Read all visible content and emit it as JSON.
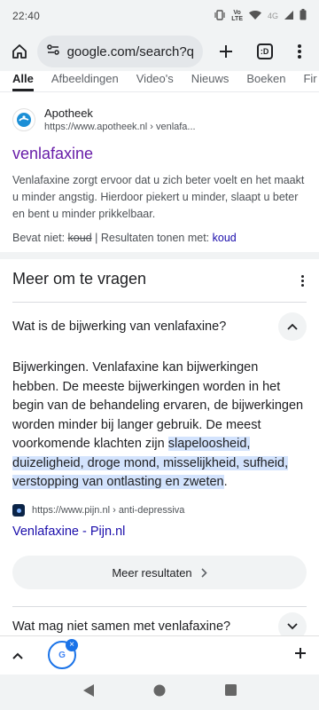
{
  "status_bar": {
    "time": "22:40",
    "network_type": "LTE",
    "signal_label": "Vo",
    "data_badge": "4G",
    "icons": [
      "vibrate-icon",
      "volte-icon",
      "wifi-icon",
      "signal-icon",
      "battery-icon"
    ]
  },
  "toolbar": {
    "url": "google.com/search?q=ven",
    "tab_count": ":D",
    "icons": [
      "home-icon",
      "site-settings-icon",
      "plus-icon",
      "tab-switcher-icon",
      "more-vert-icon"
    ]
  },
  "search_tabs": [
    "Alle",
    "Afbeeldingen",
    "Video's",
    "Nieuws",
    "Boeken",
    "Fir"
  ],
  "result": {
    "site_name": "Apotheek",
    "site_url": "https://www.apotheek.nl › venlafa...",
    "title": "venlafaxine",
    "snippet": "Venlafaxine zorgt ervoor dat u zich beter voelt en het maakt u minder angstig. Hierdoor piekert u minder, slaapt u beter en bent u minder prikkelbaar.",
    "missing_prefix": "Bevat niet: ",
    "missing_term": "koud",
    "missing_sep": " | Resultaten tonen met: ",
    "missing_link": "koud"
  },
  "paa": {
    "title": "Meer om te vragen",
    "questions": [
      {
        "text": "Wat is de bijwerking van venlafaxine?",
        "expanded": true
      },
      {
        "text": "Wat mag niet samen met venlafaxine?",
        "expanded": false
      }
    ],
    "answer_plain": "Bijwerkingen. Venlafaxine kan bijwerkingen hebben. De meeste bijwerkingen worden in het begin van de behandeling ervaren, de bijwerkingen worden minder bij langer gebruik. De meest voorkomende klachten zijn ",
    "answer_highlight": "slapeloosheid, duizeligheid, droge mond, misselijkheid, sufheid, verstopping van ontlasting en zweten",
    "answer_end": ".",
    "source_url": "https://www.pijn.nl › anti-depressiva",
    "source_title": "Venlafaxine - Pijn.nl",
    "more_button": "Meer resultaten"
  },
  "bottom_bar": {
    "tab_letter": "G",
    "close_glyph": "×"
  },
  "colors": {
    "link": "#1a0dab",
    "visited": "#681da8",
    "highlight": "#d3e3fd",
    "chrome_bg": "#f1f3f4",
    "accent": "#1a73e8"
  }
}
